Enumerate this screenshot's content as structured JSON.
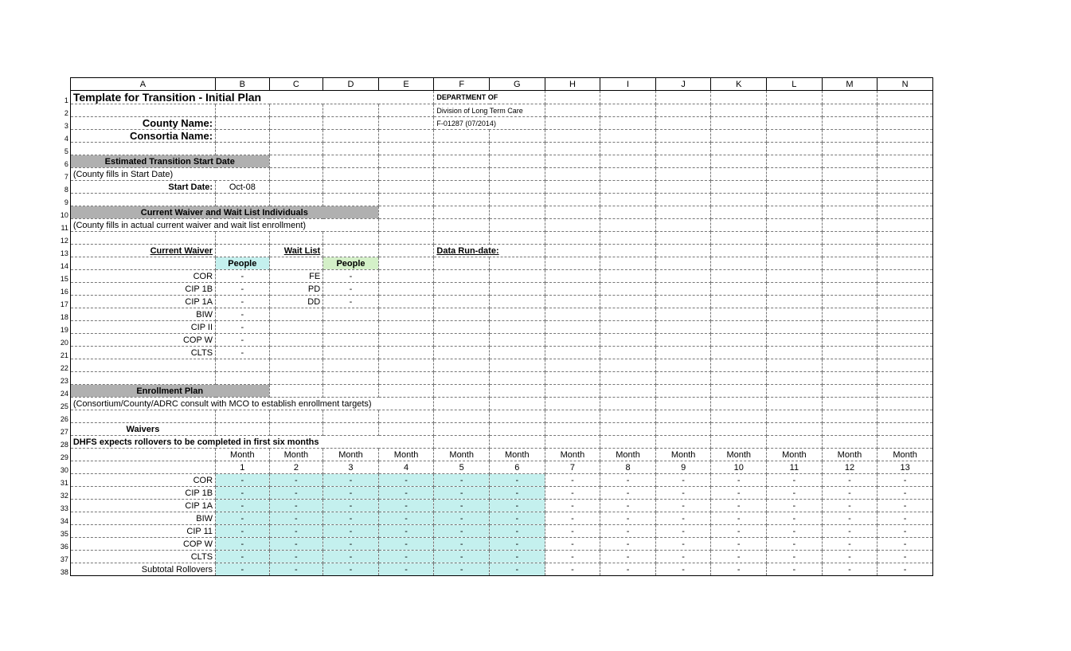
{
  "cols": [
    "A",
    "B",
    "C",
    "D",
    "E",
    "F",
    "G",
    "H",
    "I",
    "J",
    "K",
    "L",
    "M",
    "N"
  ],
  "rows": {
    "1": {
      "A": "Template for Transition - Initial Plan",
      "F": "DEPARTMENT OF"
    },
    "2": {
      "F": "Division of Long Term Care"
    },
    "3": {
      "A": "County Name:",
      "F": "F-01287 (07/2014)"
    },
    "4": {
      "A": "Consortia Name:"
    },
    "6": {
      "A": "Estimated Transition Start Date"
    },
    "7": {
      "A": "(County fills in Start Date)"
    },
    "8": {
      "A": "Start Date:",
      "B": "Oct-08"
    },
    "10": {
      "A": "Current Waiver and Wait List Individuals"
    },
    "11": {
      "A": "(County fills in actual current waiver and wait list enrollment)"
    },
    "13": {
      "A": "Current Waiver",
      "C": "Wait List",
      "F": "Data Run-date:"
    },
    "14": {
      "B": "People",
      "D": "People"
    },
    "15": {
      "A": "COR",
      "B": "-",
      "C": "FE",
      "D": "-"
    },
    "16": {
      "A": "CIP 1B",
      "B": "-",
      "C": "PD",
      "D": "-"
    },
    "17": {
      "A": "CIP 1A",
      "B": "-",
      "C": "DD",
      "D": "-"
    },
    "18": {
      "A": "BIW",
      "B": "-"
    },
    "19": {
      "A": "CIP II",
      "B": "-"
    },
    "20": {
      "A": "COP W",
      "B": "-"
    },
    "21": {
      "A": "CLTS",
      "B": "-"
    },
    "24": {
      "A": "Enrollment Plan"
    },
    "25": {
      "A": "(Consortium/County/ADRC consult with MCO to establish enrollment targets)"
    },
    "27": {
      "A": "Waivers"
    },
    "28": {
      "A": "DHFS expects rollovers to be completed in first six months"
    },
    "29": {
      "month": "Month"
    },
    "30": {
      "nums": [
        "1",
        "2",
        "3",
        "4",
        "5",
        "6",
        "7",
        "8",
        "9",
        "10",
        "11",
        "12",
        "13"
      ]
    },
    "labels31_37": [
      "COR",
      "CIP 1B",
      "CIP 1A",
      "BIW",
      "CIP 11",
      "COP W",
      "CLTS"
    ],
    "38": {
      "A": "Subtotal Rollovers"
    }
  },
  "dash": "-"
}
